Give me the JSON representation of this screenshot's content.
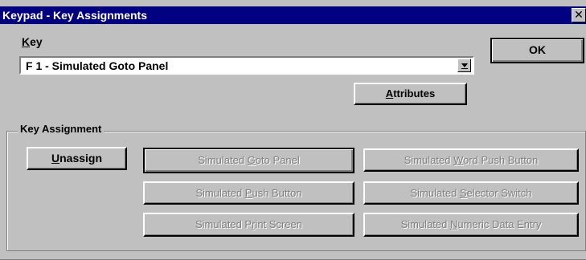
{
  "window": {
    "title": "Keypad - Key Assignments",
    "close_label": "✕"
  },
  "key": {
    "label_accel": "K",
    "label_rest": "ey",
    "selected_value": "F 1 - Simulated Goto Panel"
  },
  "buttons": {
    "ok": "OK",
    "attributes": {
      "accel": "A",
      "rest": "ttributes"
    },
    "unassign": {
      "accel": "U",
      "rest": "nassign"
    }
  },
  "key_assignment": {
    "group_label": "Key Assignment",
    "options": [
      {
        "pre": "Simulated ",
        "accel": "G",
        "post": "oto Panel",
        "enabled": false
      },
      {
        "pre": "Simulated ",
        "accel": "W",
        "post": "ord Push Button",
        "enabled": false
      },
      {
        "pre": "Simulated ",
        "accel": "P",
        "post": "ush Button",
        "enabled": false
      },
      {
        "pre": "Simulated ",
        "accel": "S",
        "post": "elector Switch",
        "enabled": false
      },
      {
        "pre": "Simulated P",
        "accel": "r",
        "post": "int Screen",
        "enabled": false
      },
      {
        "pre": "Simulated ",
        "accel": "N",
        "post": "umeric Data Entry",
        "enabled": false
      }
    ]
  }
}
